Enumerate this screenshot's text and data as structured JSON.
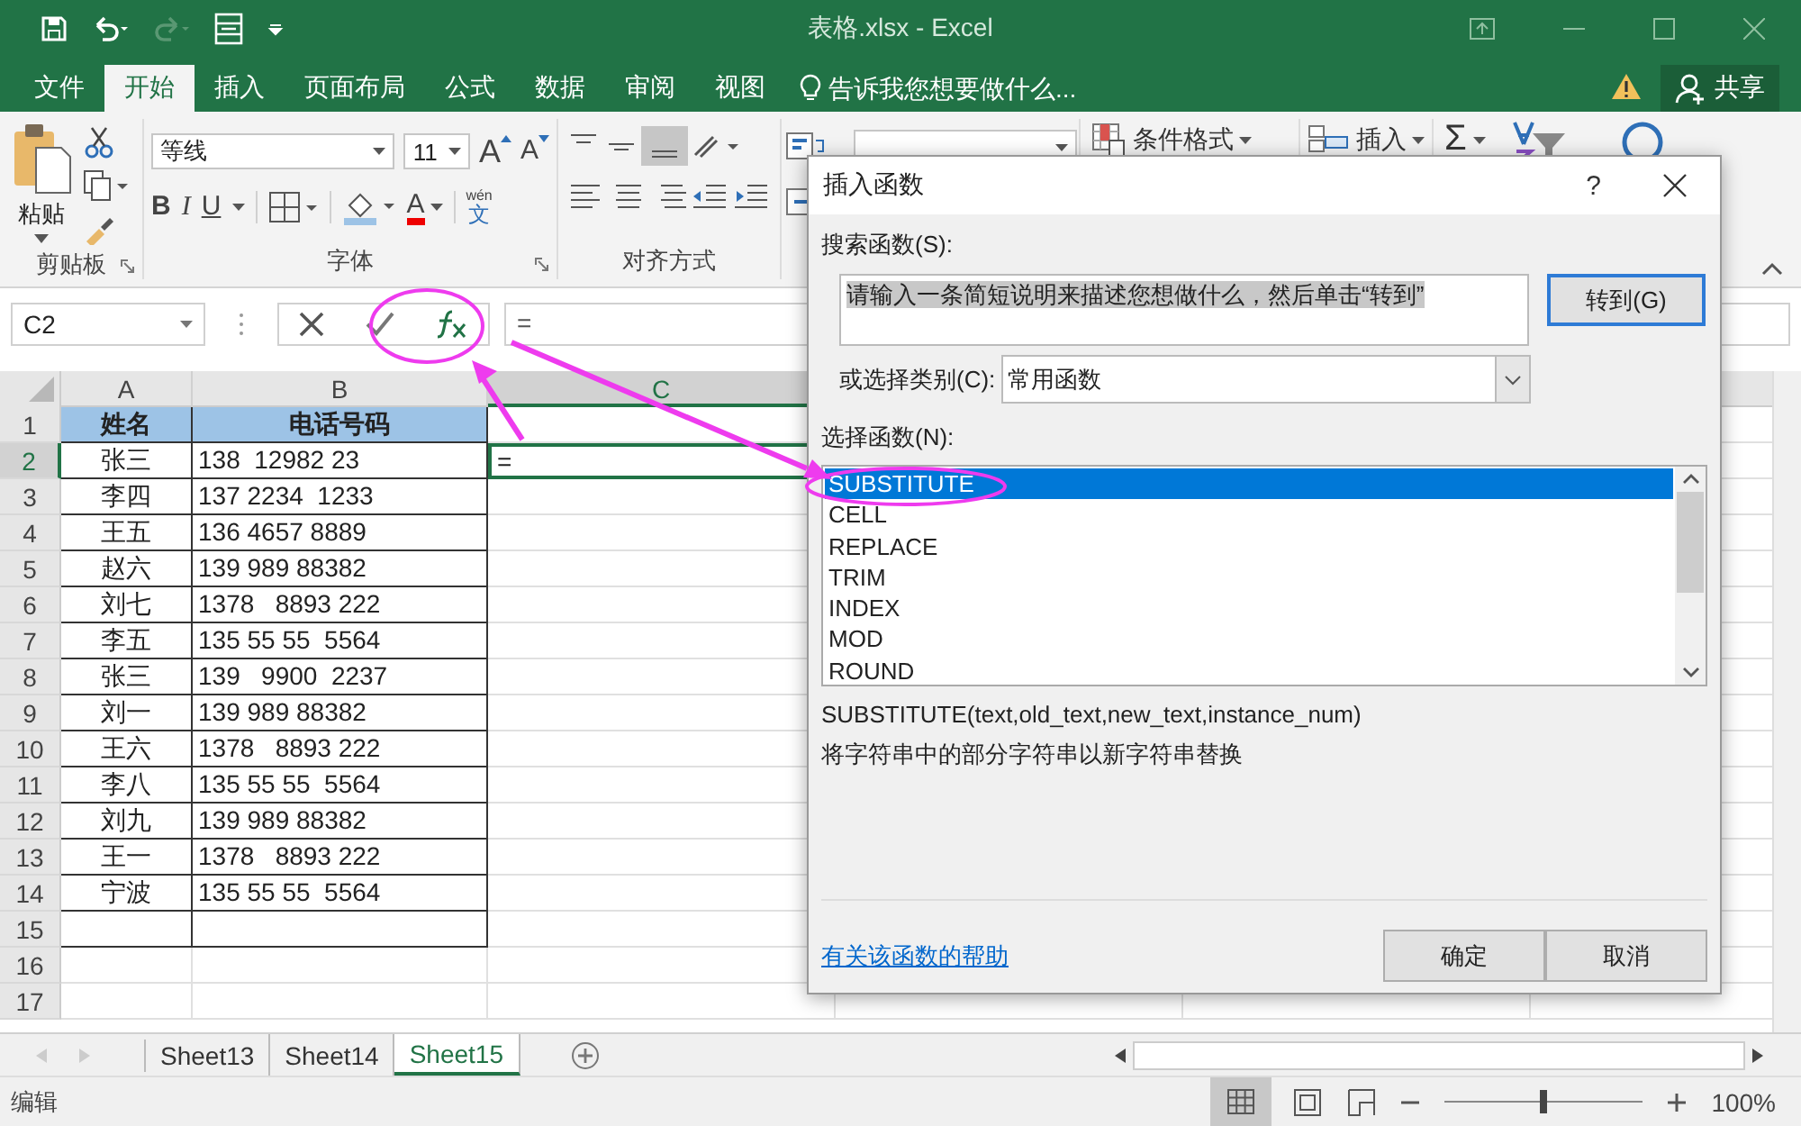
{
  "window": {
    "title": "表格.xlsx - Excel"
  },
  "ribbon_tabs": [
    {
      "label": "文件",
      "selected": false
    },
    {
      "label": "开始",
      "selected": true
    },
    {
      "label": "插入",
      "selected": false
    },
    {
      "label": "页面布局",
      "selected": false
    },
    {
      "label": "公式",
      "selected": false
    },
    {
      "label": "数据",
      "selected": false
    },
    {
      "label": "审阅",
      "selected": false
    },
    {
      "label": "视图",
      "selected": false
    }
  ],
  "tell_me": "告诉我您想要做什么...",
  "share_button": "共享",
  "ribbon": {
    "clipboard": {
      "label": "剪贴板",
      "paste": "粘贴"
    },
    "font": {
      "label": "字体",
      "name": "等线",
      "size": "11",
      "grow": "A",
      "shrink": "A",
      "bold": "B",
      "italic": "I",
      "underline": "U",
      "font_color": "A",
      "pinyin": "wén",
      "phonetic": "文"
    },
    "alignment": {
      "label": "对齐方式"
    },
    "styles": {
      "conditional_formatting": "条件格式"
    },
    "cells": {
      "insert": "插入"
    },
    "editing": {
      "autosum": "Σ"
    }
  },
  "formula_bar": {
    "name_box": "C2",
    "formula": "="
  },
  "sheet": {
    "columns": [
      {
        "label": "A",
        "selected": false
      },
      {
        "label": "B",
        "selected": false
      },
      {
        "label": "C",
        "selected": true
      }
    ],
    "row_headers": [
      {
        "label": "1",
        "selected": false
      },
      {
        "label": "2",
        "selected": true
      },
      {
        "label": "3",
        "selected": false
      },
      {
        "label": "4",
        "selected": false
      },
      {
        "label": "5",
        "selected": false
      },
      {
        "label": "6",
        "selected": false
      },
      {
        "label": "7",
        "selected": false
      },
      {
        "label": "8",
        "selected": false
      },
      {
        "label": "9",
        "selected": false
      },
      {
        "label": "10",
        "selected": false
      },
      {
        "label": "11",
        "selected": false
      },
      {
        "label": "12",
        "selected": false
      },
      {
        "label": "13",
        "selected": false
      },
      {
        "label": "14",
        "selected": false
      },
      {
        "label": "15",
        "selected": false
      },
      {
        "label": "16",
        "selected": false
      },
      {
        "label": "17",
        "selected": false
      }
    ],
    "header_row": {
      "name": "姓名",
      "phone": "电话号码"
    },
    "records": [
      {
        "name": "张三",
        "phone": "138  12982 23"
      },
      {
        "name": "李四",
        "phone": "137 2234  1233"
      },
      {
        "name": "王五",
        "phone": "136 4657 8889"
      },
      {
        "name": "赵六",
        "phone": "139 989 88382"
      },
      {
        "name": "刘七",
        "phone": "1378   8893 222"
      },
      {
        "name": "李五",
        "phone": "135 55 55  5564"
      },
      {
        "name": "张三",
        "phone": "139   9900  2237"
      },
      {
        "name": "刘一",
        "phone": "139 989 88382"
      },
      {
        "name": "王六",
        "phone": "1378   8893 222"
      },
      {
        "name": "李八",
        "phone": "135 55 55  5564"
      },
      {
        "name": "刘九",
        "phone": "139 989 88382"
      },
      {
        "name": "王一",
        "phone": "1378   8893 222"
      },
      {
        "name": "宁波",
        "phone": "135 55 55  5564"
      }
    ],
    "active_cell": {
      "value": "="
    }
  },
  "sheet_tabs": [
    {
      "label": "Sheet13",
      "selected": false
    },
    {
      "label": "Sheet14",
      "selected": false
    },
    {
      "label": "Sheet15",
      "selected": true
    }
  ],
  "status_bar": {
    "mode": "编辑",
    "zoom": "100%",
    "zoom_slider": {
      "level": 0.5
    }
  },
  "dialog": {
    "title": "插入函数",
    "help": "?",
    "search_label": "搜索函数(S):",
    "search_value": "请输入一条简短说明来描述您想做什么，然后单击“转到”",
    "go_button": "转到(G)",
    "category_label": "或选择类别(C):",
    "category_value": "常用函数",
    "list_label": "选择函数(N):",
    "functions": [
      {
        "label": "SUBSTITUTE",
        "selected": true
      },
      {
        "label": "CELL",
        "selected": false
      },
      {
        "label": "REPLACE",
        "selected": false
      },
      {
        "label": "TRIM",
        "selected": false
      },
      {
        "label": "INDEX",
        "selected": false
      },
      {
        "label": "MOD",
        "selected": false
      },
      {
        "label": "ROUND",
        "selected": false
      }
    ],
    "syntax": "SUBSTITUTE(text,old_text,new_text,instance_num)",
    "description": "将字符串中的部分字符串以新字符串替换",
    "help_link": "有关该函数的帮助",
    "ok_button": "确定",
    "cancel_button": "取消"
  }
}
